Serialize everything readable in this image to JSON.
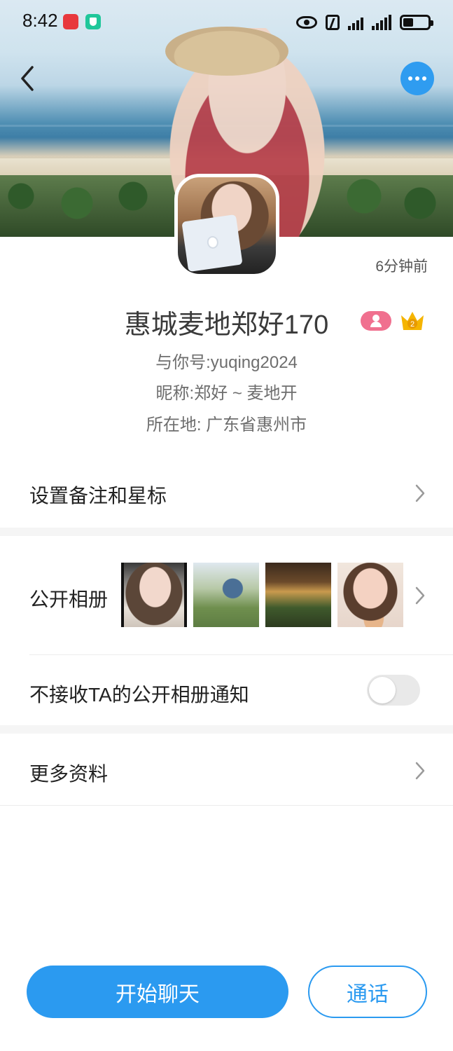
{
  "status_bar": {
    "time": "8:42"
  },
  "profile": {
    "time_ago": "6分钟前",
    "name": "惠城麦地郑好170",
    "account_line": "与你号:yuqing2024",
    "nickname_line": "昵称:郑好 ~ 麦地开",
    "location_line": "所在地: 广东省惠州市",
    "vip_level": "2"
  },
  "menu": {
    "remark_label": "设置备注和星标",
    "album_label": "公开相册",
    "album_notify_label": "不接收TA的公开相册通知",
    "album_notify_enabled": false,
    "more_info_label": "更多资料"
  },
  "actions": {
    "chat_label": "开始聊天",
    "call_label": "通话"
  },
  "colors": {
    "accent": "#2b9af0",
    "gender_badge": "#f0708f",
    "crown": "#f5b400"
  }
}
